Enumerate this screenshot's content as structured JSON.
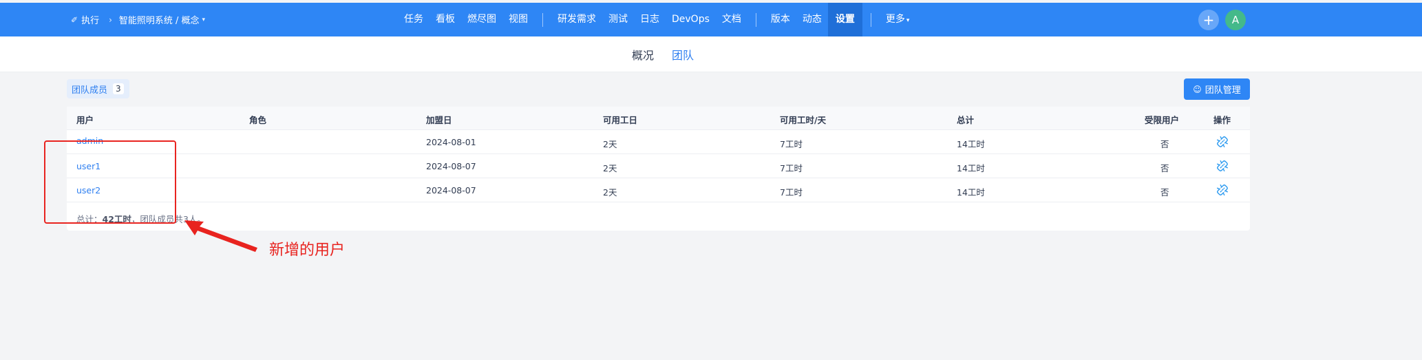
{
  "topbar": {
    "breadcrumb": {
      "section": "执行",
      "project": "智能照明系统 / 概念"
    },
    "nav": [
      "任务",
      "看板",
      "燃尽图",
      "视图",
      "研发需求",
      "测试",
      "日志",
      "DevOps",
      "文档",
      "版本",
      "动态",
      "设置",
      "更多"
    ],
    "active_nav": "设置",
    "avatar_letter": "A"
  },
  "subnav": {
    "tabs": [
      "概况",
      "团队"
    ],
    "active": "团队"
  },
  "members_tab": {
    "label": "团队成员",
    "count": "3"
  },
  "manage_button": {
    "label": "团队管理"
  },
  "table": {
    "columns": [
      "用户",
      "角色",
      "加盟日",
      "可用工日",
      "可用工时/天",
      "总计",
      "受限用户",
      "操作"
    ],
    "rows": [
      {
        "user": "admin",
        "role": "",
        "join_date": "2024-08-01",
        "work_days": "2天",
        "hours_per_day": "7工时",
        "total": "14工时",
        "restricted": "否"
      },
      {
        "user": "user1",
        "role": "",
        "join_date": "2024-08-07",
        "work_days": "2天",
        "hours_per_day": "7工时",
        "total": "14工时",
        "restricted": "否"
      },
      {
        "user": "user2",
        "role": "",
        "join_date": "2024-08-07",
        "work_days": "2天",
        "hours_per_day": "7工时",
        "total": "14工时",
        "restricted": "否"
      }
    ],
    "summary": {
      "prefix": "总计：",
      "hours": "42工时",
      "mid": "，团队成员共",
      "count": "3",
      "suffix": "人。"
    }
  },
  "annotation": {
    "text": "新增的用户"
  },
  "colors": {
    "primary": "#2e86f5",
    "annotation": "#e8231f",
    "link": "#2e7ff0"
  }
}
